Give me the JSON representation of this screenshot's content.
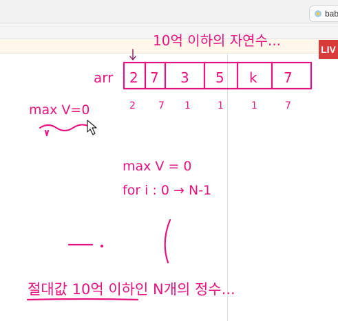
{
  "browser": {
    "tab_label": "bab",
    "live_badge": "LIV"
  },
  "board": {
    "title": "10억 이하의 자연수...",
    "array_name": "arr",
    "array_cells": [
      "2",
      "7",
      "3",
      "5",
      "k",
      "7"
    ],
    "counts": [
      "2",
      "7",
      "1",
      "1",
      "1",
      "7"
    ],
    "max_var_left": "max V=0",
    "code_line1": "max V = 0",
    "code_line2": "for i : 0 → N-1",
    "bottom_note": "절대값 10억 이하인 N개의 정수..."
  },
  "colors": {
    "ink": "#e6127f",
    "live": "#d93b3b"
  }
}
